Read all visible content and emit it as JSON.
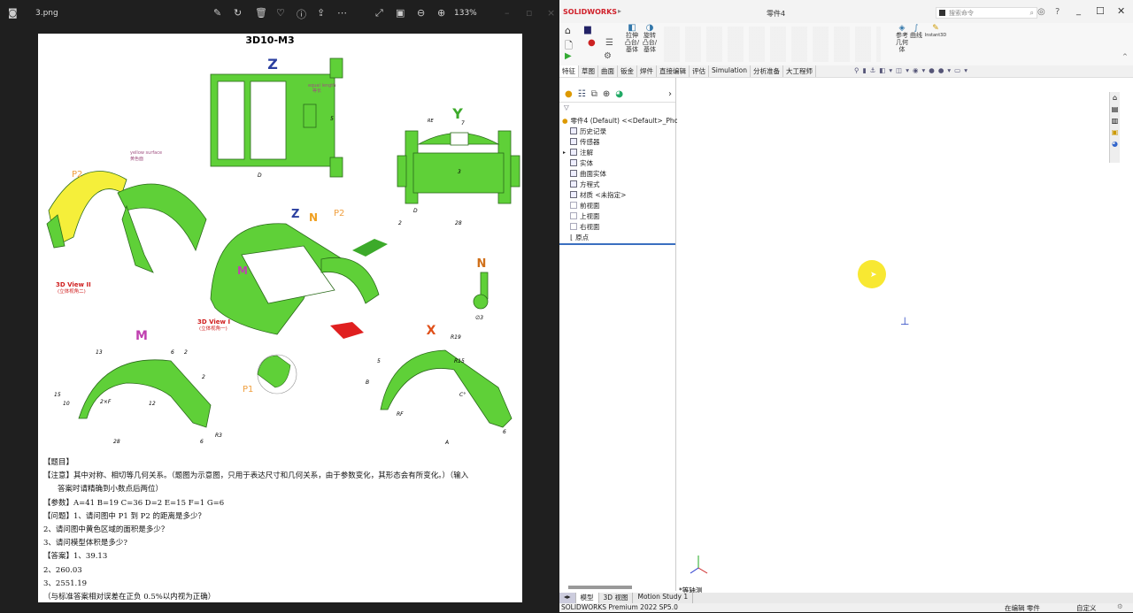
{
  "viewer": {
    "filename": "3.png",
    "zoom": "133%",
    "doc": {
      "title": "3D10-M3",
      "labels": {
        "z": "Z",
        "y": "Y",
        "n": "N",
        "m": "M",
        "x": "X",
        "p1": "P1",
        "p2": "P2",
        "p2b": "P2",
        "view1": "3D View I",
        "view1_cn": "(立体视角一)",
        "view2": "3D View II",
        "view2_cn": "(立体视角二)",
        "yellow": "yellow surface",
        "yellow_cn": "黄色面",
        "equal": "equal length",
        "equal_cn": "等长",
        "dims": {
          "d5": "5",
          "dD": "D",
          "dD2": "D",
          "d2": "2",
          "d3": "3",
          "d28": "28",
          "d7": "7",
          "dRE": "RE",
          "d13": "13",
          "d6": "6",
          "d2b": "2",
          "d2c": "2",
          "d15": "15",
          "d10": "10",
          "d12": "12",
          "d2F": "2×F",
          "dR3": "R3",
          "d6b": "6",
          "d28b": "28",
          "dR19": "R19",
          "dB": "B",
          "dC": "C°",
          "dRF": "RF",
          "dA": "A",
          "d6c": "6",
          "dphi3": "∅3",
          "dR15": "R15",
          "d5b": "5"
        }
      },
      "text": {
        "l1": "【题目】",
        "l2": "【注意】其中对称、相切等几何关系。（题图为示意图，只用于表达尺寸和几何关系，由于参数变化，其形态会有所变化。）（输入",
        "l3": "答案时请精确到小数点后两位）",
        "l4": "【参数】A=41    B=19    C=36    D=2    E=15    F=1    G=6",
        "l5": "【问题】1、请问图中 P1 到 P2 的距离是多少？",
        "l6": "2、请问图中黄色区域的面积是多少？",
        "l7": "3、请问模型体积是多少?",
        "l8": "【答案】1、39.13",
        "l9": "2、260.03",
        "l10": "3、2551.19",
        "l11": "（与标准答案相对误差在正负 0.5%以内视为正确）"
      }
    },
    "colors": {
      "green": "#5fd038",
      "yellow": "#f5ef3a"
    }
  },
  "sw": {
    "brand": "SOLIDWORKS",
    "doc_title": "零件4",
    "search_placeholder": "搜索命令",
    "ribbon": {
      "extrude": "拉伸凸台/基体",
      "revolve": "旋转凸台/基体",
      "refgeo": "参考几何体",
      "curves": "曲线",
      "instant3d": "Instant3D"
    },
    "tabs": [
      "特征",
      "草图",
      "曲面",
      "钣金",
      "焊件",
      "直接编辑",
      "评估",
      "Simulation",
      "分析准备",
      "大工程师"
    ],
    "tree": {
      "root": "零件4 (Default) <<Default>_Photo\\",
      "items": [
        "历史记录",
        "传感器",
        "注解",
        "实体",
        "曲面实体",
        "方程式",
        "材质 <未指定>",
        "前视面",
        "上视面",
        "右视面",
        "原点"
      ]
    },
    "view_label": "*等轴测",
    "bottom_tabs": [
      "模型",
      "3D 视图",
      "Motion Study 1"
    ],
    "status": {
      "version": "SOLIDWORKS Premium 2022 SP5.0",
      "mode": "在编辑 零件",
      "units": "自定义"
    }
  }
}
